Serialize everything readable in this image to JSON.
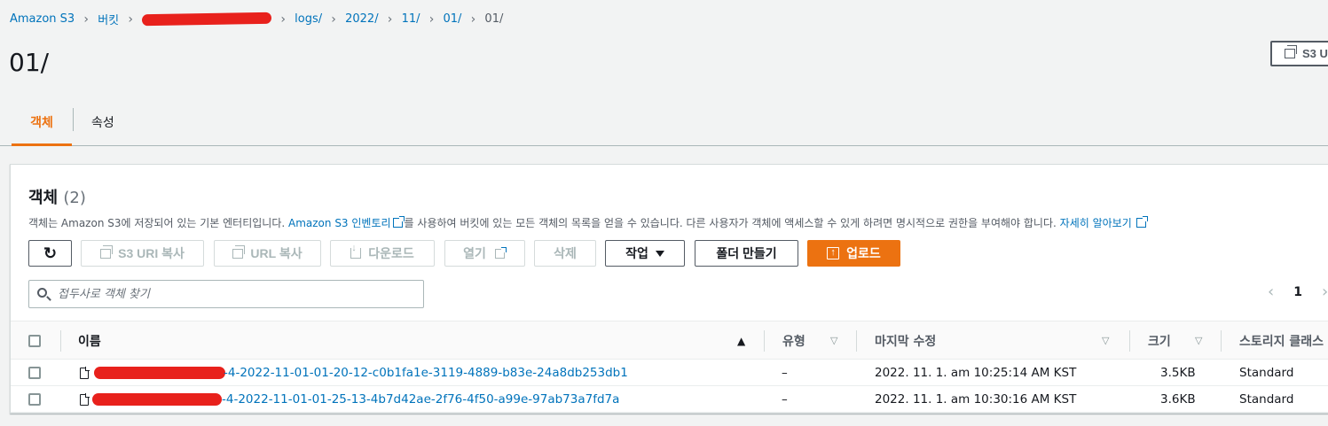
{
  "breadcrumb": {
    "root": "Amazon S3",
    "buckets": "버킷",
    "path": [
      "logs/",
      "2022/",
      "11/",
      "01/"
    ],
    "current": "01/"
  },
  "page": {
    "title": "01/",
    "copy_s3_uri_label": "S3 U"
  },
  "tabs": [
    {
      "label": "객체",
      "active": true
    },
    {
      "label": "속성",
      "active": false
    }
  ],
  "objects_panel": {
    "title": "객체",
    "count": "(2)",
    "desc_prefix": "객체는 Amazon S3에 저장되어 있는 기본 엔터티입니다. ",
    "desc_link": "Amazon S3 인벤토리",
    "desc_middle": "를 사용하여 버킷에 있는 모든 객체의 목록을 얻을 수 있습니다. 다른 사용자가 객체에 액세스할 수 있게 하려면 명시적으로 권한을 부여해야 합니다. ",
    "desc_learn_more": "자세히 알아보기"
  },
  "toolbar": {
    "copy_s3_uri": "S3 URI 복사",
    "copy_url": "URL 복사",
    "download": "다운로드",
    "open": "열기",
    "delete": "삭제",
    "actions": "작업",
    "create_folder": "폴더 만들기",
    "upload": "업로드"
  },
  "search": {
    "placeholder": "접두사로 객체 찾기",
    "value": ""
  },
  "pagination": {
    "current_page": "1"
  },
  "table": {
    "columns": [
      "이름",
      "유형",
      "마지막 수정",
      "크기",
      "스토리지 클래스"
    ],
    "rows": [
      {
        "name_visible": "-4-2022-11-01-01-20-12-c0b1fa1e-3119-4889-b83e-24a8db253db1",
        "type": "–",
        "last_modified": "2022. 11. 1. am 10:25:14 AM KST",
        "size": "3.5KB",
        "storage_class": "Standard"
      },
      {
        "name_visible": "-4-2022-11-01-01-25-13-4b7d42ae-2f76-4f50-a99e-97ab73a7fd7a",
        "type": "–",
        "last_modified": "2022. 11. 1. am 10:30:16 AM KST",
        "size": "3.6KB",
        "storage_class": "Standard"
      }
    ]
  },
  "colors": {
    "accent": "#ec7211",
    "link": "#0073bb",
    "redaction": "#e8211c"
  }
}
